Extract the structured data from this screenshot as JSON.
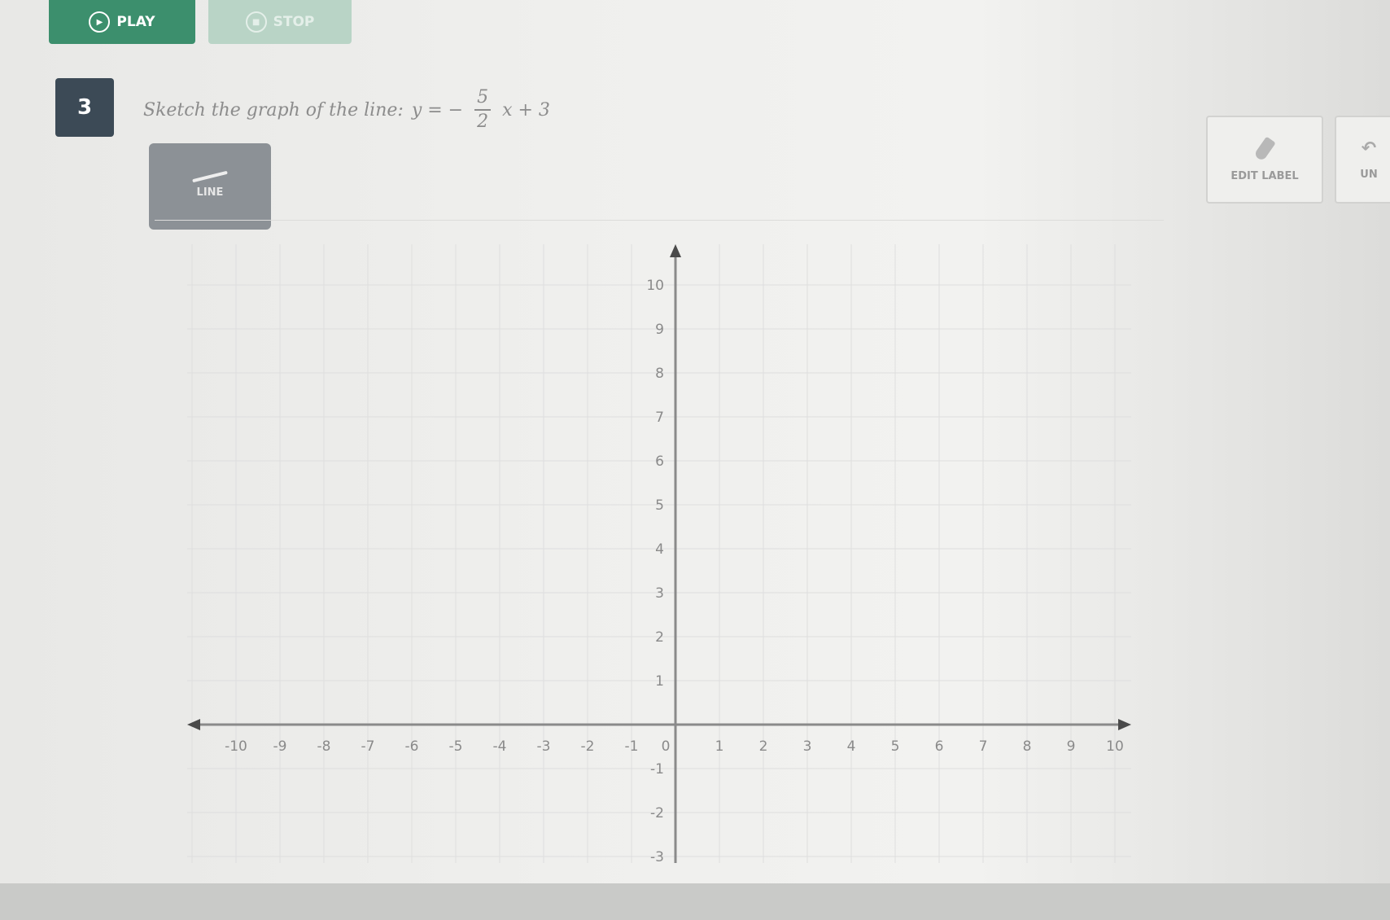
{
  "toolbar": {
    "play_label": "PLAY",
    "stop_label": "STOP"
  },
  "question": {
    "number": "3",
    "prompt": "Sketch the graph of the line:",
    "equation_lhs": "y = −",
    "fraction_numerator": "5",
    "fraction_denominator": "2",
    "equation_rhs": "x + 3"
  },
  "tools": {
    "line_label": "LINE",
    "edit_label_label": "EDIT LABEL",
    "undo_label": "UN"
  },
  "graph": {
    "x_ticks": [
      "-10",
      "-9",
      "-8",
      "-7",
      "-6",
      "-5",
      "-4",
      "-3",
      "-2",
      "-1",
      "0",
      "1",
      "2",
      "3",
      "4",
      "5",
      "6",
      "7",
      "8",
      "9",
      "10"
    ],
    "y_ticks": [
      "10",
      "9",
      "8",
      "7",
      "6",
      "5",
      "4",
      "3",
      "2",
      "1",
      "-1",
      "-2",
      "-3"
    ],
    "axis_color": "#8a8a8a",
    "grid_color": "#dedede"
  }
}
